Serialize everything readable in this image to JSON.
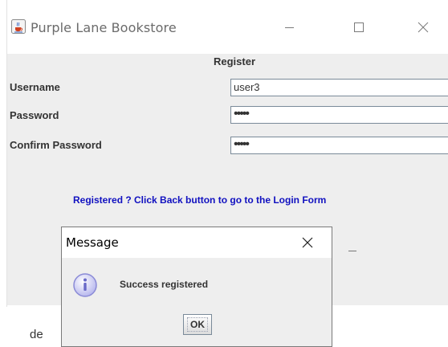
{
  "window": {
    "title": "Purple Lane Bookstore",
    "icon": "java-cup-icon",
    "controls": [
      "minimize-icon",
      "maximize-icon",
      "close-icon"
    ]
  },
  "form": {
    "heading": "Register",
    "username_label": "Username",
    "username_value": "user3",
    "password_label": "Password",
    "password_value": "•••••",
    "confirm_label": "Confirm Password",
    "confirm_value": "•••••",
    "info_text": "Registered ? Click Back button to go to the Login Form"
  },
  "dialog": {
    "title": "Message",
    "icon": "info-icon",
    "message": "Success registered",
    "ok_label": "OK"
  },
  "background_text": "de",
  "colors": {
    "link": "#1010c0",
    "window_bg": "#eeeeee",
    "info_icon": "#8a8ad6"
  }
}
